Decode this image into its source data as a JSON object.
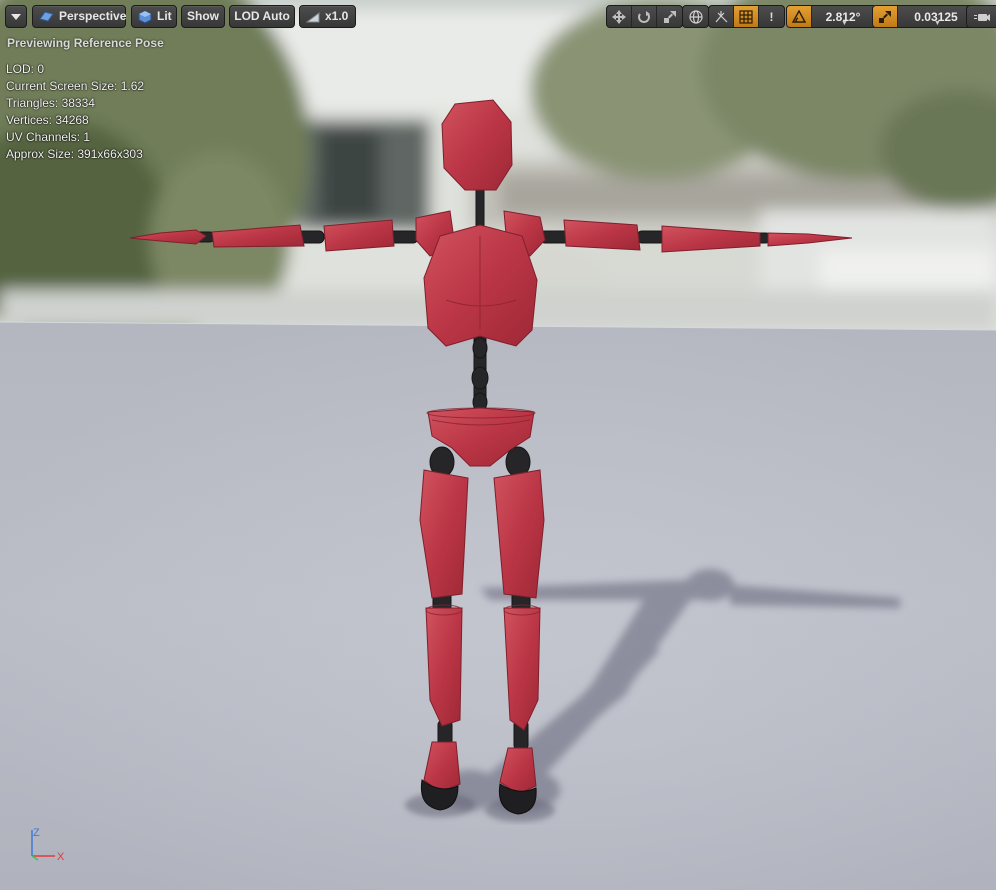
{
  "toolbar": {
    "menu_icon": "chevron-down-icon",
    "perspective_label": "Perspective",
    "lit_label": "Lit",
    "show_label": "Show",
    "lod_label": "LOD Auto",
    "speed_label": "x1.0",
    "transform_icons": [
      "translate-icon",
      "rotate-icon",
      "scale-icon"
    ],
    "world_icon": "globe-icon",
    "surface_snap_icon": "surface-snap-icon",
    "grid_icon": "grid-snap-icon",
    "warning_label": "!",
    "rotation_snap_value": "2.812°",
    "scale_snap_value": "0.03125",
    "camera_icon": "camera-speed-icon",
    "accent_color": "#d08a23"
  },
  "overlay": {
    "title": "Previewing Reference Pose",
    "stats": [
      "LOD: 0",
      "Current Screen Size: 1.62",
      "Triangles: 38334",
      "Vertices: 34268",
      "UV Channels: 1",
      "Approx Size: 391x66x303"
    ]
  },
  "axis": {
    "z_label": "Z",
    "x_label": "X",
    "z_color": "#3d7bd6",
    "x_color": "#e23b3b"
  },
  "scene": {
    "mannequin_color": "#c03c4b",
    "floor_color": "#b8bac4"
  }
}
